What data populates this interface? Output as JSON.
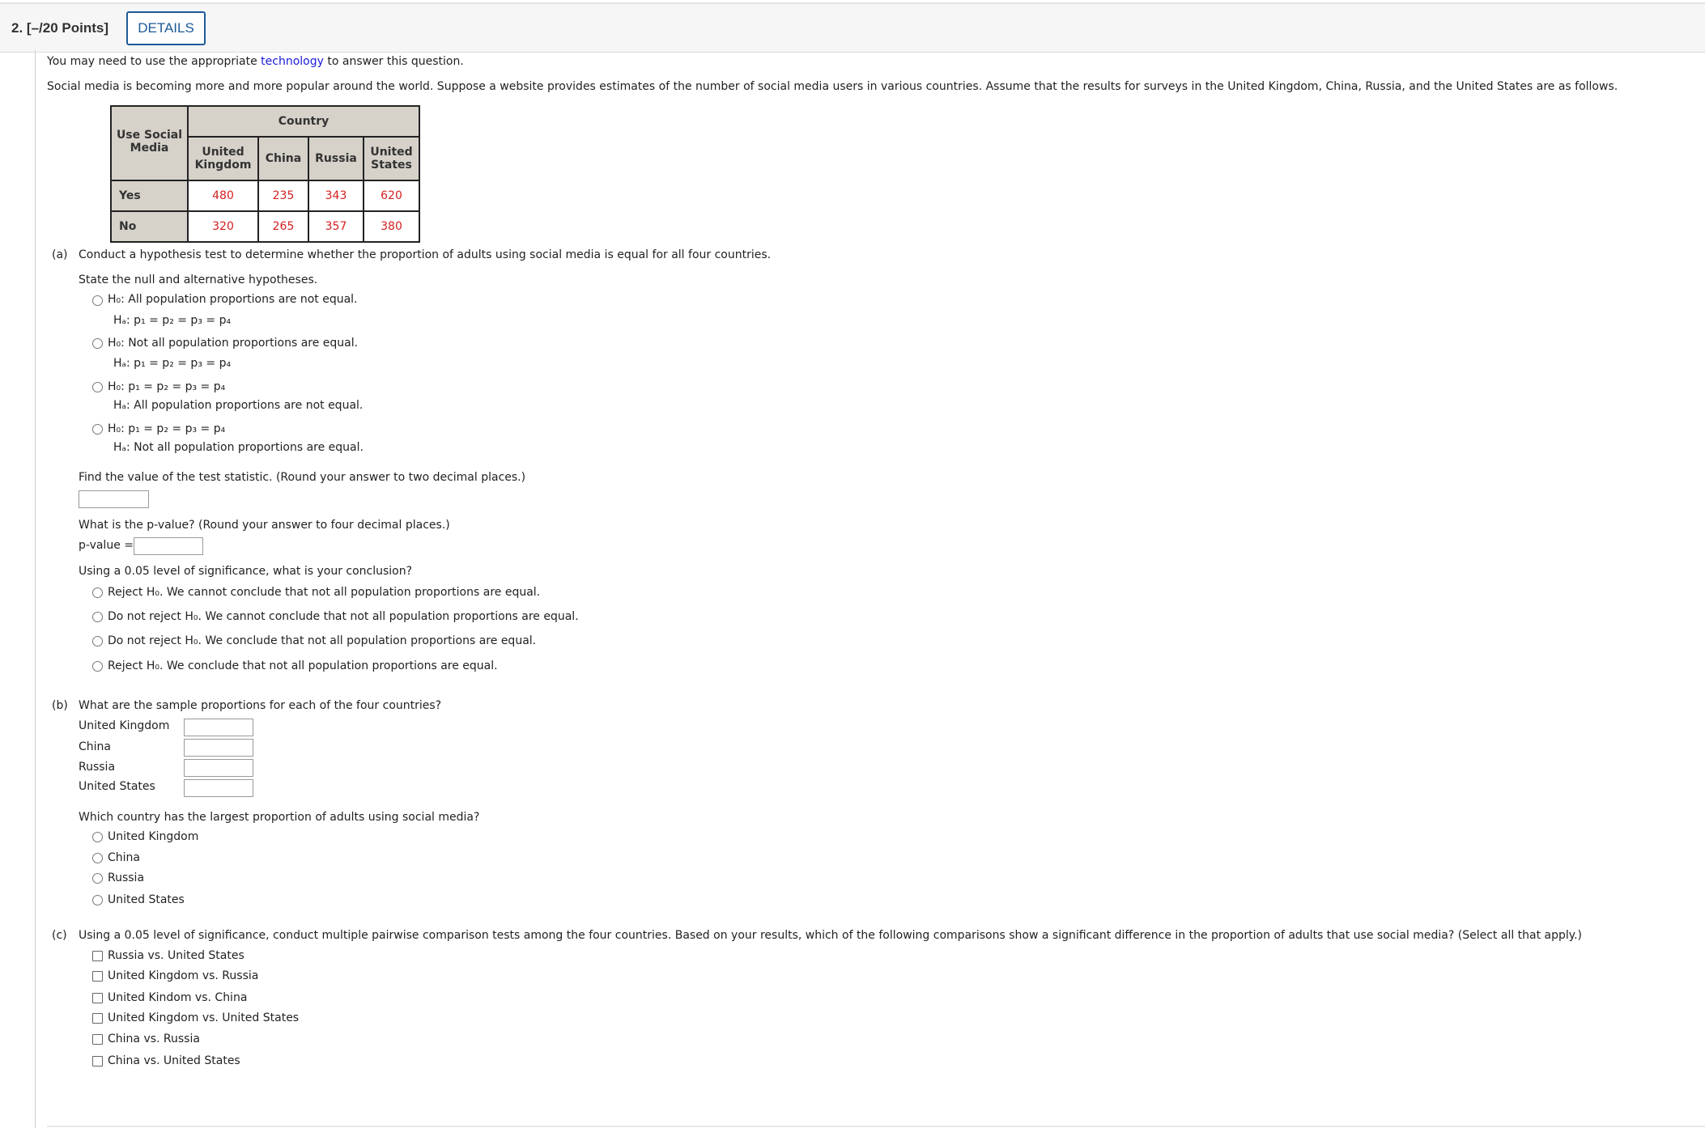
{
  "header": {
    "question_number": "2.",
    "points": "[–/20 Points]",
    "details_button": "DETAILS"
  },
  "intro": {
    "prefix": "You may need to use the appropriate ",
    "link": "technology",
    "suffix": " to answer this question."
  },
  "problem": "Social media is becoming more and more popular around the world. Suppose a website provides estimates of the number of social media users in various countries. Assume that the results for surveys in the United Kingdom, China, Russia, and the United States are as follows.",
  "table": {
    "row_header": "Use Social Media",
    "col_group": "Country",
    "columns": [
      "United Kingdom",
      "China",
      "Russia",
      "United States"
    ],
    "rows": [
      {
        "label": "Yes",
        "values": [
          "480",
          "235",
          "343",
          "620"
        ]
      },
      {
        "label": "No",
        "values": [
          "320",
          "265",
          "357",
          "380"
        ]
      }
    ],
    "value_color": "#d42020"
  },
  "part_a": {
    "label": "(a)",
    "question": "Conduct a hypothesis test to determine whether the proportion of adults using social media is equal for all four countries.",
    "hyp_prompt": "State the null and alternative hypotheses.",
    "hypotheses": [
      {
        "h0": "H₀: All population proportions are not equal.",
        "ha": "Hₐ: p₁ = p₂ = p₃ = p₄"
      },
      {
        "h0": "H₀: Not all population proportions are equal.",
        "ha": "Hₐ: p₁ = p₂ = p₃ = p₄"
      },
      {
        "h0": "H₀: p₁ = p₂ = p₃ = p₄",
        "ha": "Hₐ: All population proportions are not equal."
      },
      {
        "h0": "H₀: p₁ = p₂ = p₃ = p₄",
        "ha": "Hₐ: Not all population proportions are equal."
      }
    ],
    "stat_prompt": "Find the value of the test statistic. (Round your answer to two decimal places.)",
    "stat_value": "",
    "p_prompt": "What is the p-value? (Round your answer to four decimal places.)",
    "p_label": "p-value =",
    "p_value": "",
    "conclusion_prompt": "Using a 0.05 level of significance, what is your conclusion?",
    "conclusions": [
      "Reject H₀. We cannot conclude that not all population proportions are equal.",
      "Do not reject H₀. We cannot conclude that not all population proportions are equal.",
      "Do not reject H₀. We conclude that not all population proportions are equal.",
      "Reject H₀. We conclude that not all population proportions are equal."
    ]
  },
  "part_b": {
    "label": "(b)",
    "question": "What are the sample proportions for each of the four countries?",
    "fields": [
      {
        "label": "United Kingdom",
        "value": ""
      },
      {
        "label": "China",
        "value": ""
      },
      {
        "label": "Russia",
        "value": ""
      },
      {
        "label": "United States",
        "value": ""
      }
    ],
    "largest_prompt": "Which country has the largest proportion of adults using social media?",
    "options": [
      "United Kingdom",
      "China",
      "Russia",
      "United States"
    ]
  },
  "part_c": {
    "label": "(c)",
    "question": "Using a 0.05 level of significance, conduct multiple pairwise comparison tests among the four countries. Based on your results, which of the following comparisons show a significant difference in the proportion of adults that use social media? (Select all that apply.)",
    "options": [
      "Russia vs. United States",
      "United Kingdom vs. Russia",
      "United Kindom vs. China",
      "United Kingdom vs. United States",
      "China vs. Russia",
      "China vs. United States"
    ]
  }
}
